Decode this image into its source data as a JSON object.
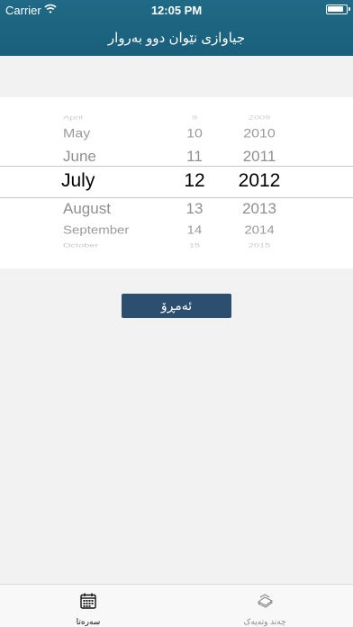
{
  "status_bar": {
    "carrier": "Carrier",
    "time": "12:05 PM"
  },
  "nav": {
    "title": "جیاوازی نێوان دوو بەروار"
  },
  "picker": {
    "months": [
      "April",
      "May",
      "June",
      "July",
      "August",
      "September",
      "October"
    ],
    "days": [
      "9",
      "10",
      "11",
      "12",
      "13",
      "14",
      "15"
    ],
    "years": [
      "2009",
      "2010",
      "2011",
      "2012",
      "2013",
      "2014",
      "2015"
    ],
    "selected": {
      "month": "July",
      "day": "12",
      "year": "2012"
    }
  },
  "actions": {
    "today_label": "ئەمڕۆ"
  },
  "tabbar": {
    "items": [
      {
        "label": "سەرەتا",
        "icon": "calendar-icon",
        "selected": true
      },
      {
        "label": "چەند وتەیەک",
        "icon": "papers-icon",
        "selected": false
      }
    ]
  },
  "colors": {
    "nav_background": "#1d6481",
    "button_background": "#2c4f70"
  }
}
